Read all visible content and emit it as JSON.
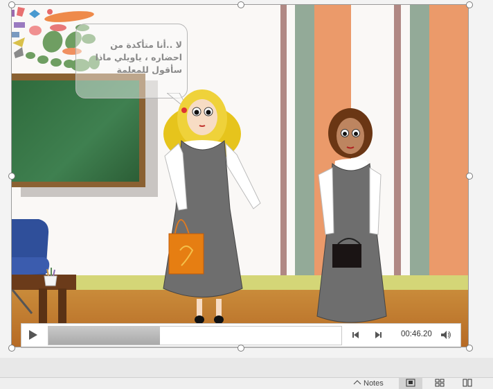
{
  "slide": {
    "speech_bubble_text": "لا ..أنا متأكدة من احضاره ، ياويلي ماذا سأقول للمعلمة"
  },
  "media_controls": {
    "time": "00:46.20",
    "progress_fraction": 0.38
  },
  "status_bar": {
    "notes_label": "Notes"
  },
  "colors": {
    "accent_orange": "#eb9a6a",
    "stripe_green": "#93aa98",
    "chalkboard": "#3f8050"
  }
}
